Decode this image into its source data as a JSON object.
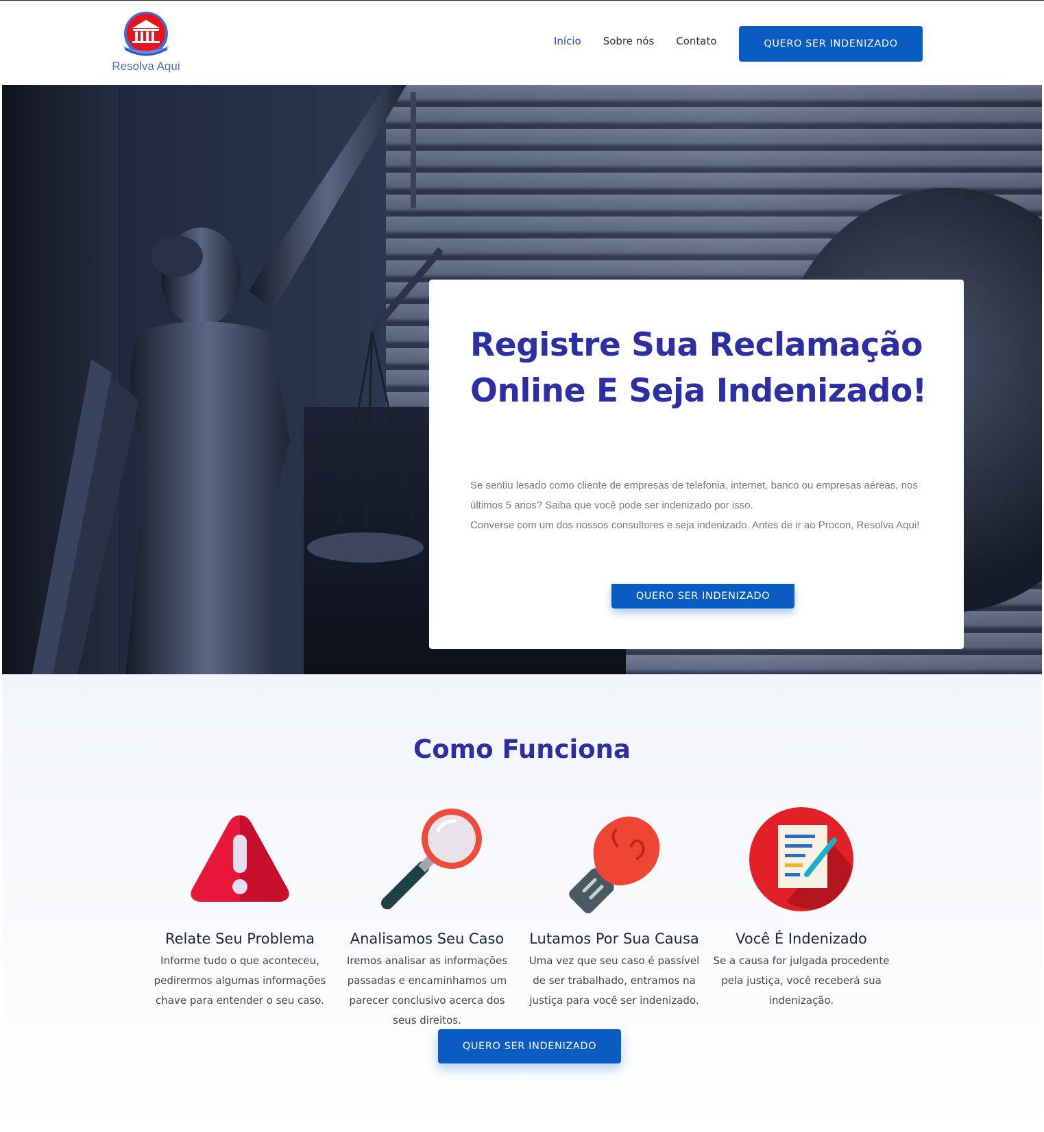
{
  "brand": {
    "name": "Resolva Aqui"
  },
  "nav": {
    "items": [
      {
        "label": "Início",
        "active": true
      },
      {
        "label": "Sobre nós",
        "active": false
      },
      {
        "label": "Contato",
        "active": false
      }
    ],
    "cta_label": "QUERO SER INDENIZADO"
  },
  "hero": {
    "title": "Registre Sua Reclamação Online E Seja Indenizado!",
    "paragraph_1": "Se sentiu lesado como cliente de empresas de telefonia, internet, banco ou empresas aéreas,  nos últimos 5 anos? Saiba que você pode ser indenizado por isso.",
    "paragraph_2": "Converse com um dos nossos consultores e seja indenizado. Antes de ir ao Procon, Resolva Aqui!",
    "cta_label": "QUERO SER INDENIZADO"
  },
  "how_it_works": {
    "title": "Como Funciona",
    "steps": [
      {
        "icon": "warning-icon",
        "title": "Relate Seu Problema",
        "text": "Informe tudo o que aconteceu, pedirermos algumas informações chave para entender o seu caso."
      },
      {
        "icon": "magnifier-icon",
        "title": "Analisamos Seu Caso",
        "text": "Iremos analisar as informações passadas e encaminhamos um parecer conclusivo acerca dos seus direitos."
      },
      {
        "icon": "boxing-glove-icon",
        "title": "Lutamos Por Sua Causa",
        "text": "Uma vez que seu caso é passível de ser trabalhado, entramos na justiça para você ser indenizado."
      },
      {
        "icon": "document-icon",
        "title": "Você É Indenizado",
        "text": "Se a causa for julgada procedente pela justiça, você receberá sua indenização."
      }
    ],
    "cta_label": "QUERO SER INDENIZADO"
  },
  "colors": {
    "primary": "#0a5cc2",
    "heading": "#2b2fa3",
    "logo_red": "#e8141b"
  }
}
